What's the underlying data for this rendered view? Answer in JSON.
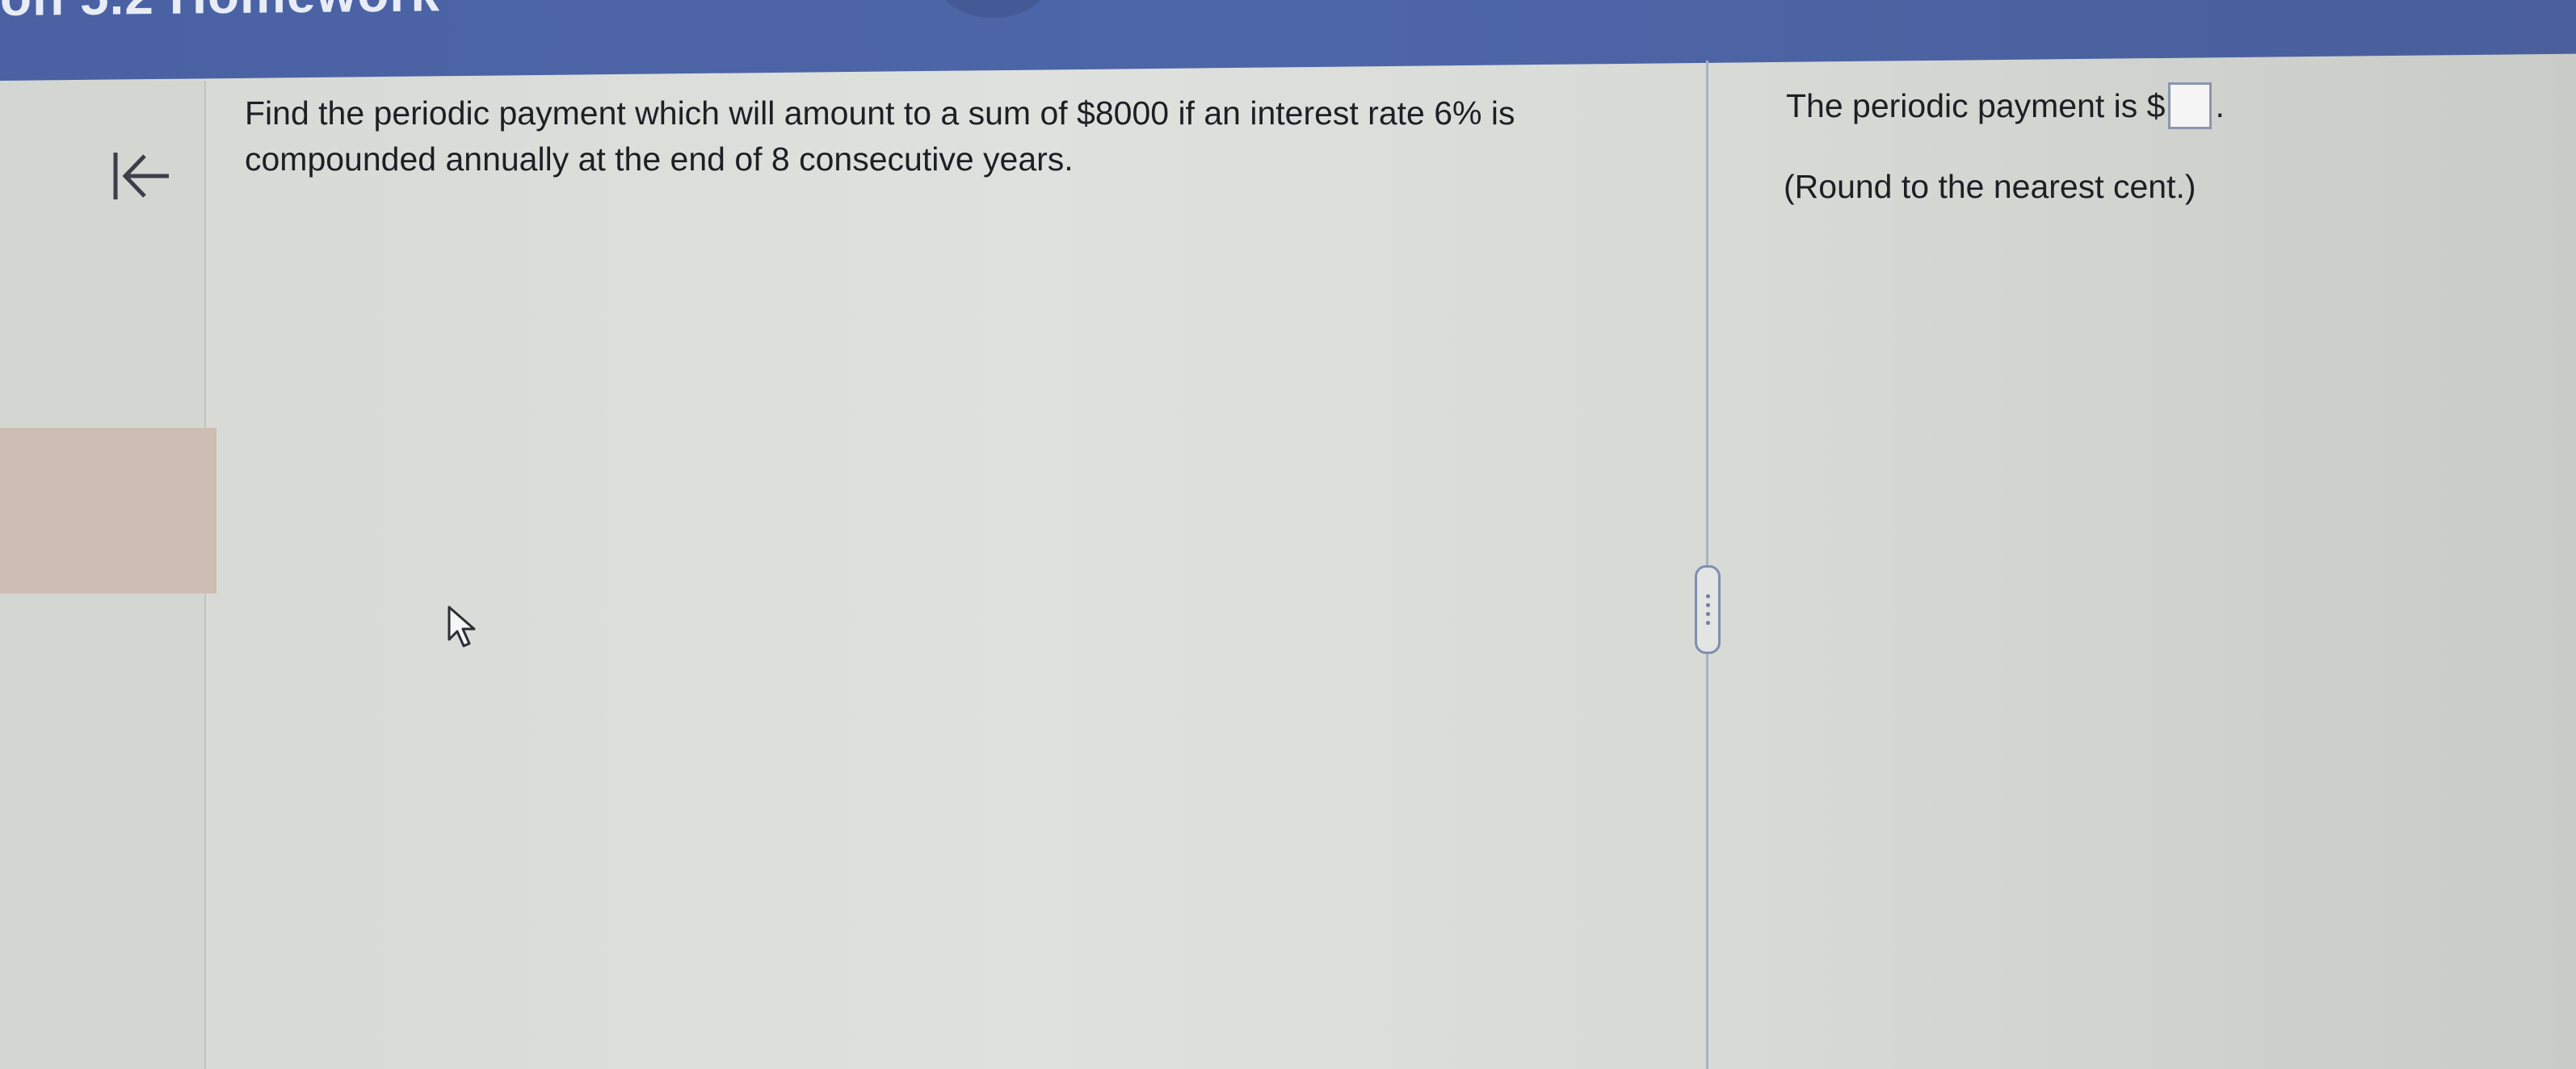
{
  "header": {
    "title": "on 5.2 Homework"
  },
  "nav": {
    "back_icon": "collapse-left-icon"
  },
  "question": {
    "line1": "Find the periodic payment which will amount to a sum of $8000 if an interest rate 6% is",
    "line2": "compounded annually at the end of 8 consecutive years."
  },
  "answer": {
    "prefix": "The periodic payment is $",
    "suffix": ".",
    "value": "",
    "note": "(Round to the nearest cent.)"
  },
  "colors": {
    "header_bg": "#4a62a4",
    "text": "#1d1f24",
    "answer_box_border": "#8a96ad"
  }
}
